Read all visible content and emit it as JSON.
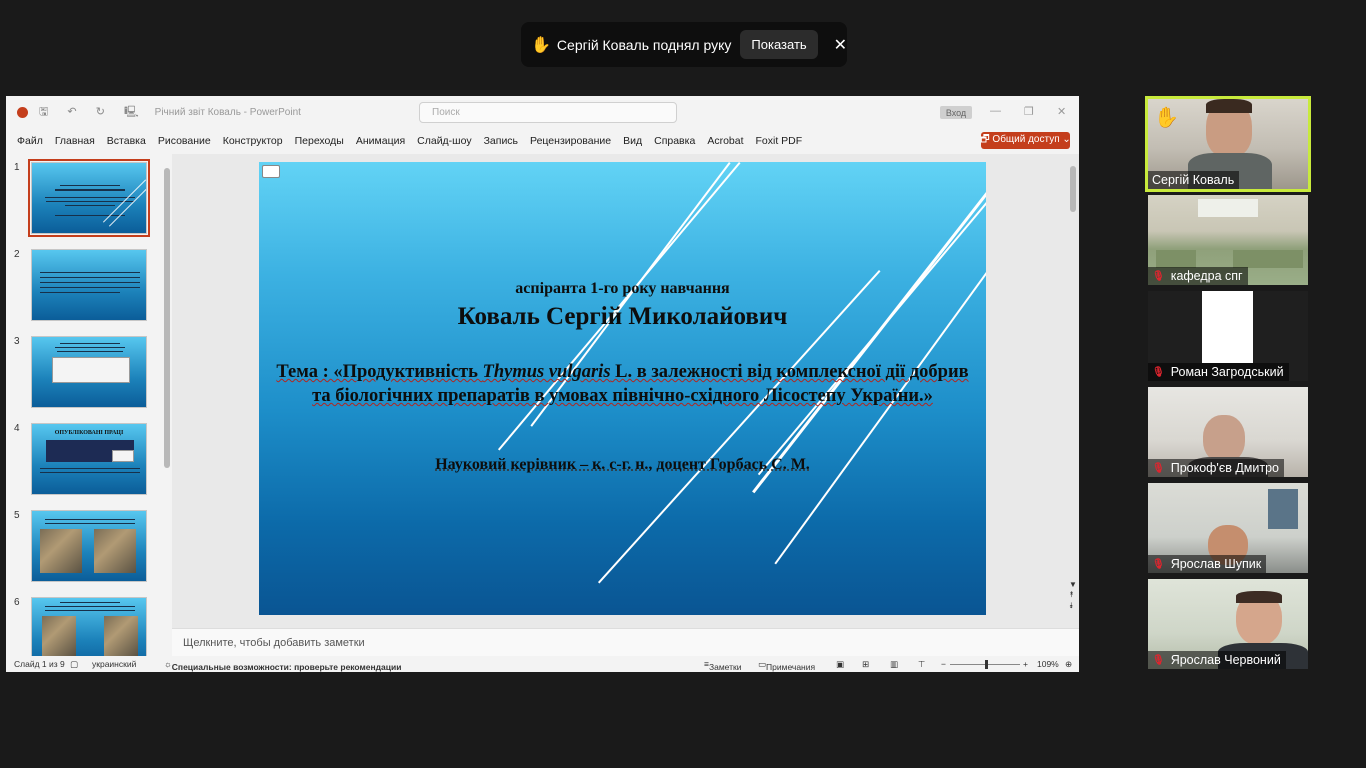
{
  "notification": {
    "message": "Сергій Коваль поднял руку",
    "show_label": "Показать",
    "close_glyph": "✕",
    "hand_glyph": "✋"
  },
  "ppt": {
    "doc_title": "Річний звіт Коваль  -  PowerPoint",
    "quick_access": "🖫 ↶ ↻ 🖳",
    "search_placeholder": "Поиск",
    "sign_in_label": "Вход",
    "minimize_glyph": "—",
    "maximize_glyph": "❐",
    "close_glyph": "✕",
    "menu": [
      "Файл",
      "Главная",
      "Вставка",
      "Рисование",
      "Конструктор",
      "Переходы",
      "Анимация",
      "Слайд-шоу",
      "Запись",
      "Рецензирование",
      "Вид",
      "Справка",
      "Acrobat",
      "Foxit PDF"
    ],
    "share_label": "🗗 Общий доступ ⌄",
    "thumb_numbers": [
      "1",
      "2",
      "3",
      "4",
      "5",
      "6"
    ],
    "thumb_titles": [
      "",
      "",
      "",
      "ОПУБЛІКОВАНІ ПРАЦІ",
      "",
      ""
    ],
    "slide": {
      "line1": "аспіранта 1-го року навчання",
      "line2": "Коваль Сергій Миколайович",
      "topic_prefix": "Тема : «Продуктивність ",
      "topic_italic": "Thymus vulgaris",
      "topic_mid": " L. в залежності від комплексної дії добрив та біологічних препаратів в умовах північно-східного Лісостепу ",
      "topic_end": "України.»",
      "advisor": "Науковий керівник – к. с-г. н., доцент Горбась С. М."
    },
    "notes_placeholder": "Щелкните, чтобы добавить заметки",
    "status": {
      "slide_counter": "Слайд 1 из 9",
      "language": "украинский",
      "accessibility": "Специальные возможности: проверьте рекомендации",
      "notes": "Заметки",
      "comments": "Примечания",
      "zoom": "109%",
      "zoom_minus": "−",
      "zoom_plus": "+"
    }
  },
  "participants": [
    {
      "name": "Сергій Коваль",
      "muted": false,
      "hand_raised": true
    },
    {
      "name": "кафедра спг",
      "muted": true
    },
    {
      "name": "Роман Загродський",
      "muted": true
    },
    {
      "name": "Прокоф'єв Дмитро",
      "muted": true
    },
    {
      "name": "Ярослав Шупик",
      "muted": true
    },
    {
      "name": "Ярослав Червоний",
      "muted": true
    }
  ],
  "icons": {
    "mic_muted": "🎙",
    "hand": "✋"
  },
  "colors": {
    "accent_red": "#c43e1c",
    "speaker_border": "#c8ea3c",
    "mic_muted": "#e0242e"
  }
}
